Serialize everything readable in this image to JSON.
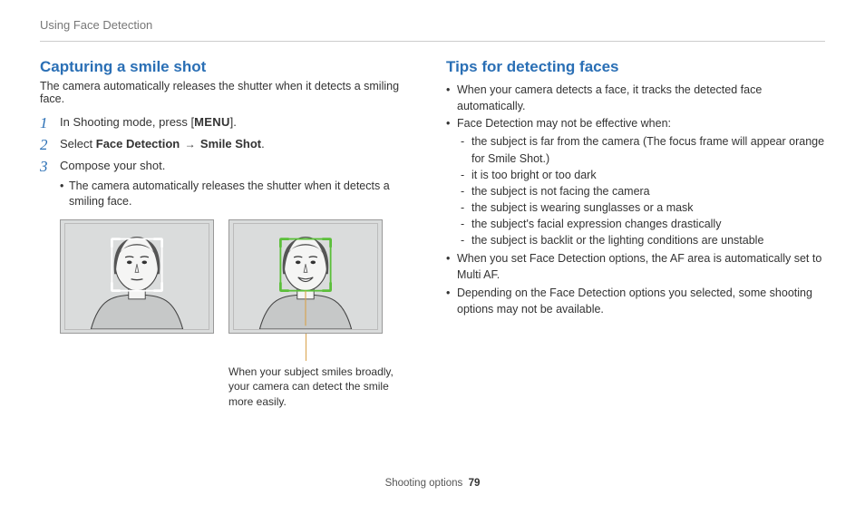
{
  "breadcrumb": "Using Face Detection",
  "footer_section": "Shooting options",
  "footer_page": "79",
  "left": {
    "title": "Capturing a smile shot",
    "intro": "The camera automatically releases the shutter when it detects a smiling face.",
    "step1_prefix": "In Shooting mode, press [",
    "step1_button": "MENU",
    "step1_suffix": "].",
    "step2_prefix": "Select ",
    "step2_bold_a": "Face Detection",
    "step2_bold_b": "Smile Shot",
    "step2_suffix": ".",
    "step3": "Compose your shot.",
    "step3_sub": "The camera automatically releases the shutter when it detects a smiling face.",
    "caption": "When your subject smiles broadly, your camera can detect the smile more easily.",
    "detect_color_neutral": "#ffffff",
    "detect_color_smile": "#5bbf3a"
  },
  "right": {
    "title": "Tips for detecting faces",
    "b1": "When your camera detects a face, it tracks the detected face automatically.",
    "b2": "Face Detection may not be effective when:",
    "s1": "the subject is far from the camera (The focus frame will appear orange for Smile Shot.)",
    "s2": "it is too bright or too dark",
    "s3": "the subject is not facing the camera",
    "s4": "the subject is wearing sunglasses or a mask",
    "s5": "the subject's facial expression changes drastically",
    "s6": "the subject is backlit or the lighting conditions are unstable",
    "b3": "When you set Face Detection options, the AF area is automatically set to Multi AF.",
    "b4": "Depending on the Face Detection options you selected, some shooting options may not be available."
  }
}
